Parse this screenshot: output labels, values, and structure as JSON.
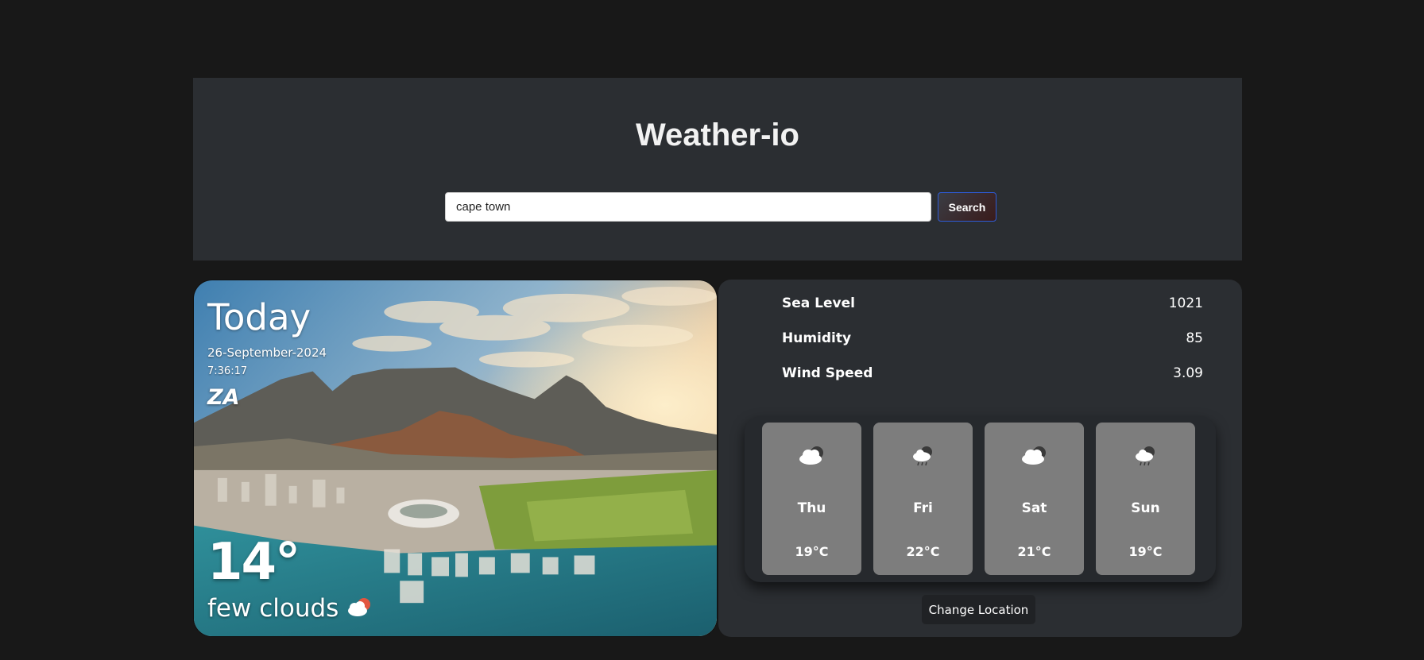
{
  "header": {
    "title": "Weather-io",
    "search_value": "cape town",
    "search_button_label": "Search"
  },
  "today": {
    "label": "Today",
    "date": "26-September-2024",
    "time": "7:36:17",
    "country": "ZA",
    "temperature": "14°",
    "condition": "few clouds",
    "condition_icon": "cloud-sun-icon"
  },
  "stats": [
    {
      "label": "Sea Level",
      "value": "1021"
    },
    {
      "label": "Humidity",
      "value": "85"
    },
    {
      "label": "Wind Speed",
      "value": "3.09"
    }
  ],
  "forecast": [
    {
      "day": "Thu",
      "temp": "19°C",
      "icon": "cloud-icon"
    },
    {
      "day": "Fri",
      "temp": "22°C",
      "icon": "cloud-rain-icon"
    },
    {
      "day": "Sat",
      "temp": "21°C",
      "icon": "cloud-icon"
    },
    {
      "day": "Sun",
      "temp": "19°C",
      "icon": "cloud-rain-icon"
    }
  ],
  "change_location_label": "Change Location",
  "colors": {
    "page_bg": "#181818",
    "panel_bg": "#2b2e32",
    "forecast_tile": "#7d7d7d",
    "search_border": "#2e5bd6"
  }
}
